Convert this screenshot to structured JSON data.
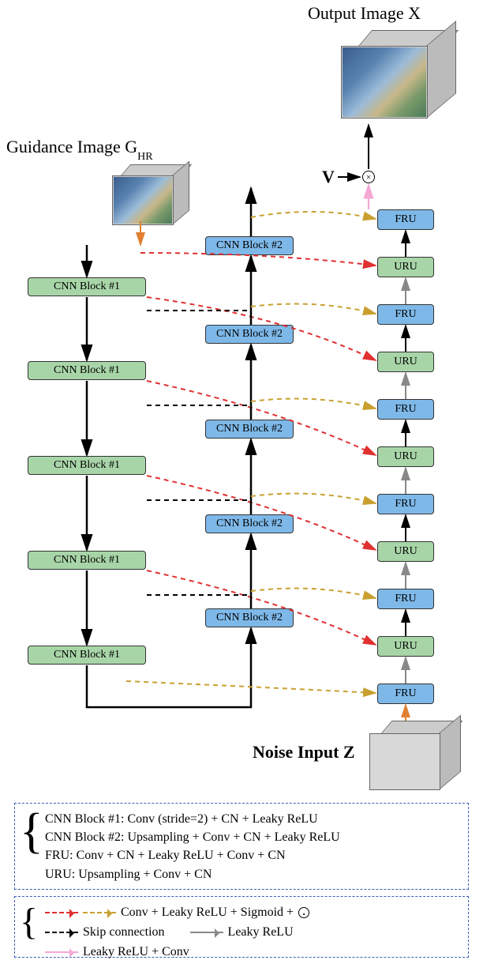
{
  "titles": {
    "output": "Output Image X",
    "guidance": "Guidance Image G",
    "guidance_sub": "HR",
    "noise": "Noise Input Z",
    "V": "V"
  },
  "blocks": {
    "cnn1": "CNN Block #1",
    "cnn2": "CNN Block #2",
    "fru": "FRU",
    "uru": "URU"
  },
  "symbols": {
    "mult": "×",
    "arrow": "→"
  },
  "legend1": {
    "cnn1": "CNN Block #1: Conv (stride=2) + CN + Leaky ReLU",
    "cnn2": "CNN Block #2: Upsampling + Conv + CN + Leaky ReLU",
    "fru": "FRU: Conv + CN + Leaky ReLU + Conv + CN",
    "uru": "URU: Upsampling + Conv + CN"
  },
  "legend2": {
    "redgold": "Conv + Leaky ReLU + Sigmoid + ",
    "skip": "Skip connection",
    "leaky": "Leaky ReLU",
    "pinkconv": "Leaky ReLU + Conv"
  },
  "chart_data": {
    "type": "diagram",
    "title": "Network architecture diagram",
    "inputs": [
      "Guidance Image G_HR",
      "Noise Input Z"
    ],
    "output": "Output Image X",
    "left_encoder": {
      "block_type": "CNN Block #1",
      "definition": "Conv (stride=2) + CN + Leaky ReLU",
      "count": 5,
      "levels": [
        1,
        2,
        3,
        4,
        5
      ]
    },
    "middle_decoder": {
      "block_type": "CNN Block #2",
      "definition": "Upsampling + Conv + CN + Leaky ReLU",
      "count": 5,
      "levels": [
        5,
        4,
        3,
        2,
        1
      ]
    },
    "right_branch": {
      "units": [
        "FRU",
        "URU",
        "FRU",
        "URU",
        "FRU",
        "URU",
        "FRU",
        "URU",
        "FRU",
        "URU",
        "FRU"
      ],
      "FRU_definition": "Conv + CN + Leaky ReLU + Conv + CN",
      "URU_definition": "Upsampling + Conv + CN",
      "guidance_to_URU_op": "Conv + Leaky ReLU + Sigmoid + elementwise-multiply",
      "decoder_to_FRU_op": "Conv + Leaky ReLU + Sigmoid + elementwise-multiply",
      "between_units_op": "Leaky ReLU",
      "output_head": "elementwise-multiply by V, then Leaky ReLU + Conv"
    },
    "skip_connections": "CNN Block #1 level k → CNN Block #2 level k (black dashed)",
    "vertical_spine": "solid black arrows down left column, then across bottom, then up through CNN Block #2 column"
  }
}
